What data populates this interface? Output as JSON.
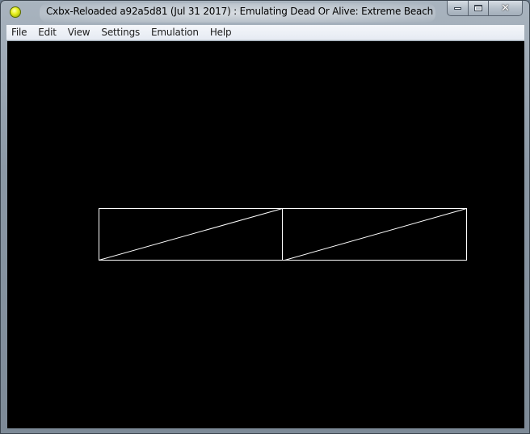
{
  "window": {
    "title": "Cxbx-Reloaded a92a5d81 (Jul 31 2017) : Emulating Dead Or Alive: Extreme Beach Volleyball",
    "icon": "xbox-orb-icon",
    "controls": {
      "minimize_icon": "minimize-icon",
      "maximize_icon": "maximize-icon",
      "close_icon": "close-icon",
      "close_glyph": "✕"
    }
  },
  "menu": {
    "items": [
      {
        "label": "File"
      },
      {
        "label": "Edit"
      },
      {
        "label": "View"
      },
      {
        "label": "Settings"
      },
      {
        "label": "Emulation"
      },
      {
        "label": "Help"
      }
    ]
  },
  "viewport": {
    "background": "#000000",
    "stroke_color": "#ffffff",
    "shapes": "two wireframe rectangles each split by a diagonal line"
  }
}
